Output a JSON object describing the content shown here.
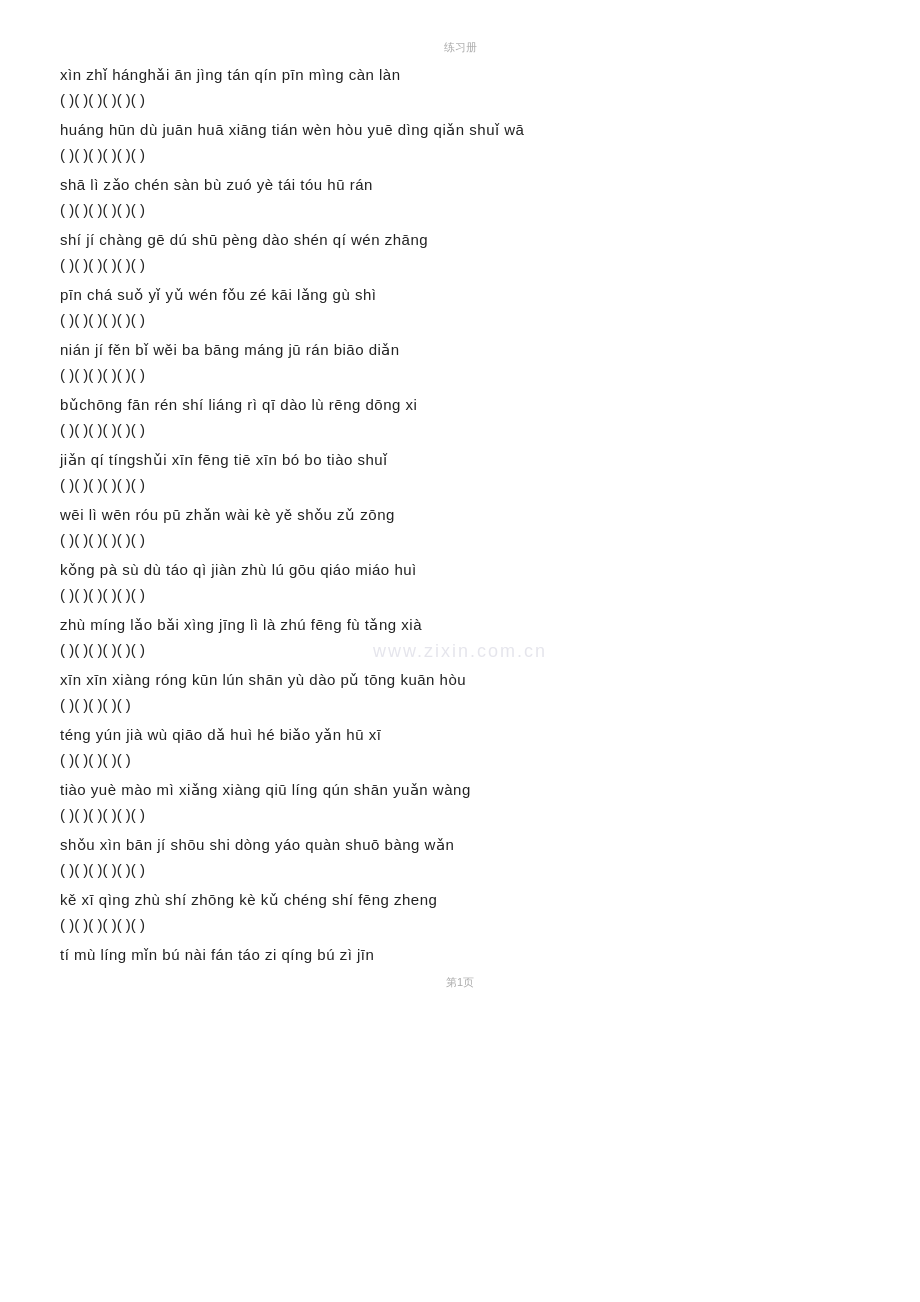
{
  "top_label": "练习册",
  "bottom_label": "第1页",
  "watermark": "www.zixin.com.cn",
  "rows": [
    {
      "pinyin": "xìn zhǐ   hánghǎi   ān jìng   tán qín   pīn mìng   càn làn",
      "brackets": "(       )(       )(       )(       )(       )(       )"
    },
    {
      "pinyin": "huáng hūn  dù juān huā  xiāng tián   wèn hòu   yuē dìng   qiǎn shuǐ wā",
      "brackets": "(       )(       )(       )(       )(       )(       )"
    },
    {
      "pinyin": "shā lì   zǎo chén   sàn bù   zuó yè   tái tóu   hū rán",
      "brackets": "(       )(       )(       )(       )(       )(       )"
    },
    {
      "pinyin": " shí jí   chàng gē   dú shū   pèng dào   shén qí   wén zhāng",
      "brackets": "(       )(       )(       )(       )(       )(       )"
    },
    {
      "pinyin": " pīn chá   suǒ yǐ   yǔ wén   fǒu zé   kāi lǎng   gù shì",
      "brackets": "(       )(       )(       )(       )(       )(       )"
    },
    {
      "pinyin": " nián jí   fěn bǐ   wěi ba   bāng máng   jū rán   biāo diǎn",
      "brackets": "(       )(       )(       )(       )(       )(       )"
    },
    {
      "pinyin": "bǔchōng   fān rén   shí liáng   rì qī   dào lù   rēng dōng xi",
      "brackets": "(       )(       )(       )(       )(       )(       )"
    },
    {
      "pinyin": "jiǎn qí   tíngshǔi   xīn fēng   tiē xīn   bó bo   tiào shuǐ",
      "brackets": "(       )(       )(       )(       )(       )(       )"
    },
    {
      "pinyin": "wēi lì   wēn róu   pū zhǎn   wài kè   yě shǒu   zǔ zōng",
      "brackets": "(       )(       )(       )(       )(       )(       )"
    },
    {
      "pinyin": "kǒng pà   sù dù   táo qì   jiàn zhù   lú gōu qiáo   miáo huì",
      "brackets": "(       )(       )(       )(       )(       )(       )"
    },
    {
      "pinyin": "zhù míng   lǎo bǎi xìng   jīng lì   là zhú   fēng fù   tǎng xià",
      "brackets": "(       )(       )(       )(       )(       )(       )"
    },
    {
      "pinyin": "xīn xīn xiàng róng   kūn lún shān   yù dào   pǔ tōng   kuān hòu",
      "brackets": "(            )(       )(       )(       )(       )"
    },
    {
      "pinyin": "téng yún jià wù   qiāo dǎ   huì hé   biǎo yǎn   hū xī",
      "brackets": "(            )(       )(       )(       )(       )"
    },
    {
      "pinyin": "tiào yuè   mào mì   xiǎng xiàng   qiū líng   qún shān   yuǎn wàng",
      "brackets": "(       )(       )(       )(       )(       )(       )"
    },
    {
      "pinyin": "shǒu xìn   bān jí   shōu shi   dòng yáo   quàn shuō   bàng wǎn",
      "brackets": "(       )(       )(       )(       )(       )(       )"
    },
    {
      "pinyin": "kě xī   qìng zhù   shí zhōng   kè kǔ   chéng shí   fēng zheng",
      "brackets": "(       )(       )(       )(       )(       )(       )"
    },
    {
      "pinyin": " tí mù   líng mǐn   bú nài fán   táo zi   qíng bú zì jīn",
      "brackets": ""
    }
  ]
}
